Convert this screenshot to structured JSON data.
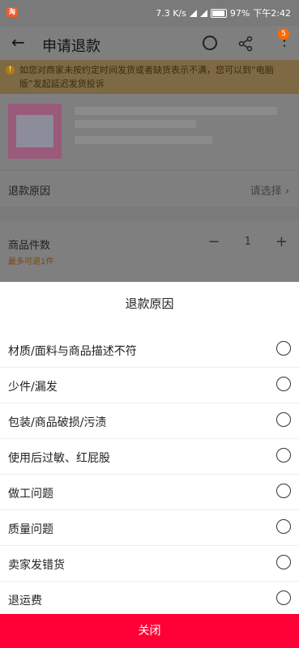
{
  "status_bar": {
    "app_badge": "淘",
    "speed": "7.3 K/s",
    "battery": "97%",
    "time": "下午2:42"
  },
  "header": {
    "title": "申请退款",
    "back_icon": "arrow-left",
    "badge_count": "5"
  },
  "notice": {
    "icon_text": "!",
    "text": "如您对商家未按约定时间发货或者缺货表示不满，您可以到“电脑版”发起延迟发货投诉"
  },
  "form": {
    "refund_reason_label": "退款原因",
    "refund_reason_value": "请选择",
    "quantity_label": "商品件数",
    "quantity_limit": "最多可退1件",
    "quantity_value": "1",
    "minus": "−",
    "plus": "+"
  },
  "sheet": {
    "title": "退款原因",
    "reasons": [
      "材质/面料与商品描述不符",
      "少件/漏发",
      "包装/商品破损/污渍",
      "使用后过敏、红屁股",
      "做工问题",
      "质量问题",
      "卖家发错货",
      "退运费"
    ],
    "close_label": "关闭"
  },
  "colors": {
    "accent": "#ff0036",
    "badge": "#ff6a00"
  }
}
